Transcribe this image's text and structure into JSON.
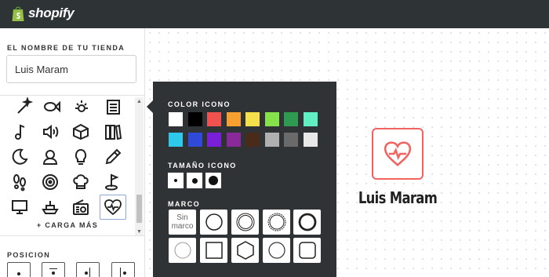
{
  "header": {
    "logo_text": "shopify"
  },
  "sidebar": {
    "store_name_label": "EL NOMBRE DE TU TIENDA",
    "store_name_value": "Luis Maram",
    "icons": [
      "wand-icon",
      "fish-icon",
      "sun-icon",
      "newspaper-icon",
      "music-note-icon",
      "speaker-icon",
      "cube-icon",
      "books-icon",
      "moon-icon",
      "person-icon",
      "lightbulb-icon",
      "pencil-icon",
      "footprints-icon",
      "target-icon",
      "chef-hat-icon",
      "golf-flag-icon",
      "monitor-icon",
      "ship-icon",
      "radio-icon",
      "heart-pulse-icon"
    ],
    "selected_icon": "heart-pulse-icon",
    "load_more": "+ CARGA MÁS",
    "position_label": "POSICION"
  },
  "popover": {
    "color_label": "COLOR ICONO",
    "colors": [
      "#ffffff",
      "#000000",
      "#f0524f",
      "#f7a030",
      "#f5e04a",
      "#86e24b",
      "#2e9b50",
      "#5ef0c0",
      "#2ec8ea",
      "#3049d8",
      "#7a1fd8",
      "#8a2a9a",
      "#4a2a18",
      "#b0b0b0",
      "#6a6a6a",
      "#e8e8e8"
    ],
    "size_label": "TAMAÑO ICONO",
    "frame_label": "MARCO",
    "no_frame_label": "Sin marco"
  },
  "preview": {
    "name": "Luis Maram",
    "icon": "heart-pulse-icon",
    "accent_color": "#ef6461"
  }
}
